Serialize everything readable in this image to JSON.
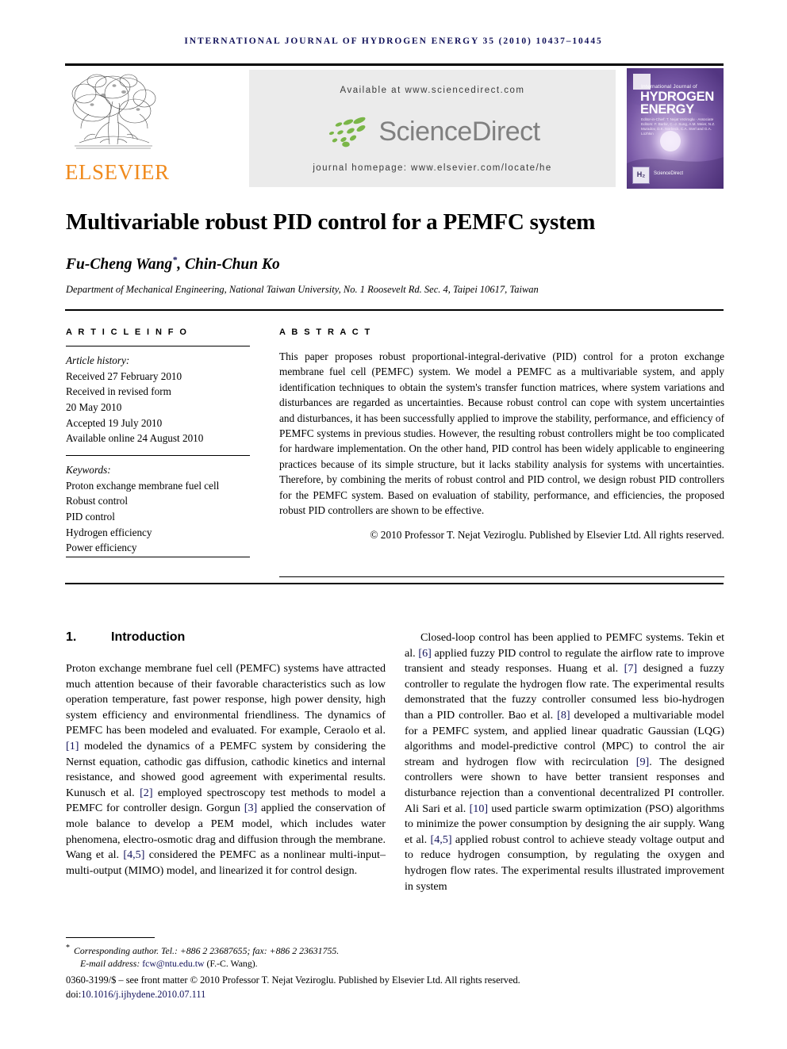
{
  "running_head": "INTERNATIONAL JOURNAL OF HYDROGEN ENERGY 35 (2010) 10437–10445",
  "masthead": {
    "publisher_name": "ELSEVIER",
    "available_at": "Available at www.sciencedirect.com",
    "sciencedirect_logo_text": "ScienceDirect",
    "journal_homepage": "journal homepage: www.elsevier.com/locate/he",
    "cover": {
      "line1": "International Journal of",
      "line2": "HYDROGEN",
      "line3": "ENERGY",
      "editors": "Editor-in-Chief: T. Nejat Veziroglu  ·  Associate Editors: F. Barbir, C.-J. Sung, A.M. Meier, N.Z. Muradov, D.K. Norbeck, C.A. Sterl and G.A. Lozhkin",
      "badge": "H₂",
      "sciencedirect": "ScienceDirect"
    }
  },
  "article": {
    "title": "Multivariable robust PID control for a PEMFC system",
    "authors": "Fu-Cheng Wang, Chin-Chun Ko",
    "corresponding_marker": "*",
    "affiliation": "Department of Mechanical Engineering, National Taiwan University, No. 1 Roosevelt Rd. Sec. 4, Taipei 10617, Taiwan"
  },
  "info": {
    "heading": "A R T I C L E   I N F O",
    "history_label": "Article history:",
    "history": [
      "Received 27 February 2010",
      "Received in revised form",
      "20 May 2010",
      "Accepted 19 July 2010",
      "Available online 24 August 2010"
    ],
    "keywords_label": "Keywords:",
    "keywords": [
      "Proton exchange membrane fuel cell",
      "Robust control",
      "PID control",
      "Hydrogen efficiency",
      "Power efficiency"
    ]
  },
  "abstract": {
    "heading": "A B S T R A C T",
    "body": "This paper proposes robust proportional-integral-derivative (PID) control for a proton exchange membrane fuel cell (PEMFC) system. We model a PEMFC as a multivariable system, and apply identification techniques to obtain the system's transfer function matrices, where system variations and disturbances are regarded as uncertainties. Because robust control can cope with system uncertainties and disturbances, it has been successfully applied to improve the stability, performance, and efficiency of PEMFC systems in previous studies. However, the resulting robust controllers might be too complicated for hardware implementation. On the other hand, PID control has been widely applicable to engineering practices because of its simple structure, but it lacks stability analysis for systems with uncertainties. Therefore, by combining the merits of robust control and PID control, we design robust PID controllers for the PEMFC system. Based on evaluation of stability, performance, and efficiencies, the proposed robust PID controllers are shown to be effective.",
    "copyright": "© 2010 Professor T. Nejat Veziroglu. Published by Elsevier Ltd. All rights reserved."
  },
  "section": {
    "number": "1.",
    "title": "Introduction"
  },
  "body": {
    "left_paragraph_parts": [
      "Proton exchange membrane fuel cell (PEMFC) systems have attracted much attention because of their favorable characteristics such as low operation temperature, fast power response, high power density, high system efficiency and environmental friendliness. The dynamics of PEMFC has been modeled and evaluated. For example, Ceraolo et al. ",
      "[1]",
      " modeled the dynamics of a PEMFC system by considering the Nernst equation, cathodic gas diffusion, cathodic kinetics and internal resistance, and showed good agreement with experimental results. Kunusch et al. ",
      "[2]",
      " employed spectroscopy test methods to model a PEMFC for controller design. Gorgun ",
      "[3]",
      " applied the conservation of mole balance to develop a PEM model, which includes water phenomena, electro-osmotic drag and diffusion through the membrane. Wang et al. ",
      "[4,5]",
      " considered the PEMFC as a nonlinear multi-input–multi-output (MIMO) model, and linearized it for control design."
    ],
    "right_paragraph_parts": [
      "Closed-loop control has been applied to PEMFC systems. Tekin et al. ",
      "[6]",
      " applied fuzzy PID control to regulate the airflow rate to improve transient and steady responses. Huang et al. ",
      "[7]",
      " designed a fuzzy controller to regulate the hydrogen flow rate. The experimental results demonstrated that the fuzzy controller consumed less bio-hydrogen than a PID controller. Bao et al. ",
      "[8]",
      " developed a multivariable model for a PEMFC system, and applied linear quadratic Gaussian (LQG) algorithms and model-predictive control (MPC) to control the air stream and hydrogen flow with recirculation ",
      "[9]",
      ". The designed controllers were shown to have better transient responses and disturbance rejection than a conventional decentralized PI controller. Ali Sari et al. ",
      "[10]",
      " used particle swarm optimization (PSO) algorithms to minimize the power consumption by designing the air supply. Wang et al. ",
      "[4,5]",
      " applied robust control to achieve steady voltage output and to reduce hydrogen consumption, by regulating the oxygen and hydrogen flow rates. The experimental results illustrated improvement in system"
    ]
  },
  "footer": {
    "corresponding_star": "*",
    "corresponding": "Corresponding author. Tel.: +886 2 23687655; fax: +886 2 23631755.",
    "email_label": "E-mail address:",
    "email": "fcw@ntu.edu.tw",
    "email_suffix": "(F.-C. Wang).",
    "front_matter": "0360-3199/$ – see front matter © 2010 Professor T. Nejat Veziroglu. Published by Elsevier Ltd. All rights reserved.",
    "doi_label": "doi:",
    "doi": "10.1016/j.ijhydene.2010.07.111"
  },
  "colors": {
    "running_head": "#12125a",
    "elsevier_orange": "#f08a1c",
    "sciencedirect_gray": "#808080",
    "sciencedirect_green": "#7ab648",
    "banner_bg": "#ebebeb",
    "link_blue": "#12125a"
  }
}
